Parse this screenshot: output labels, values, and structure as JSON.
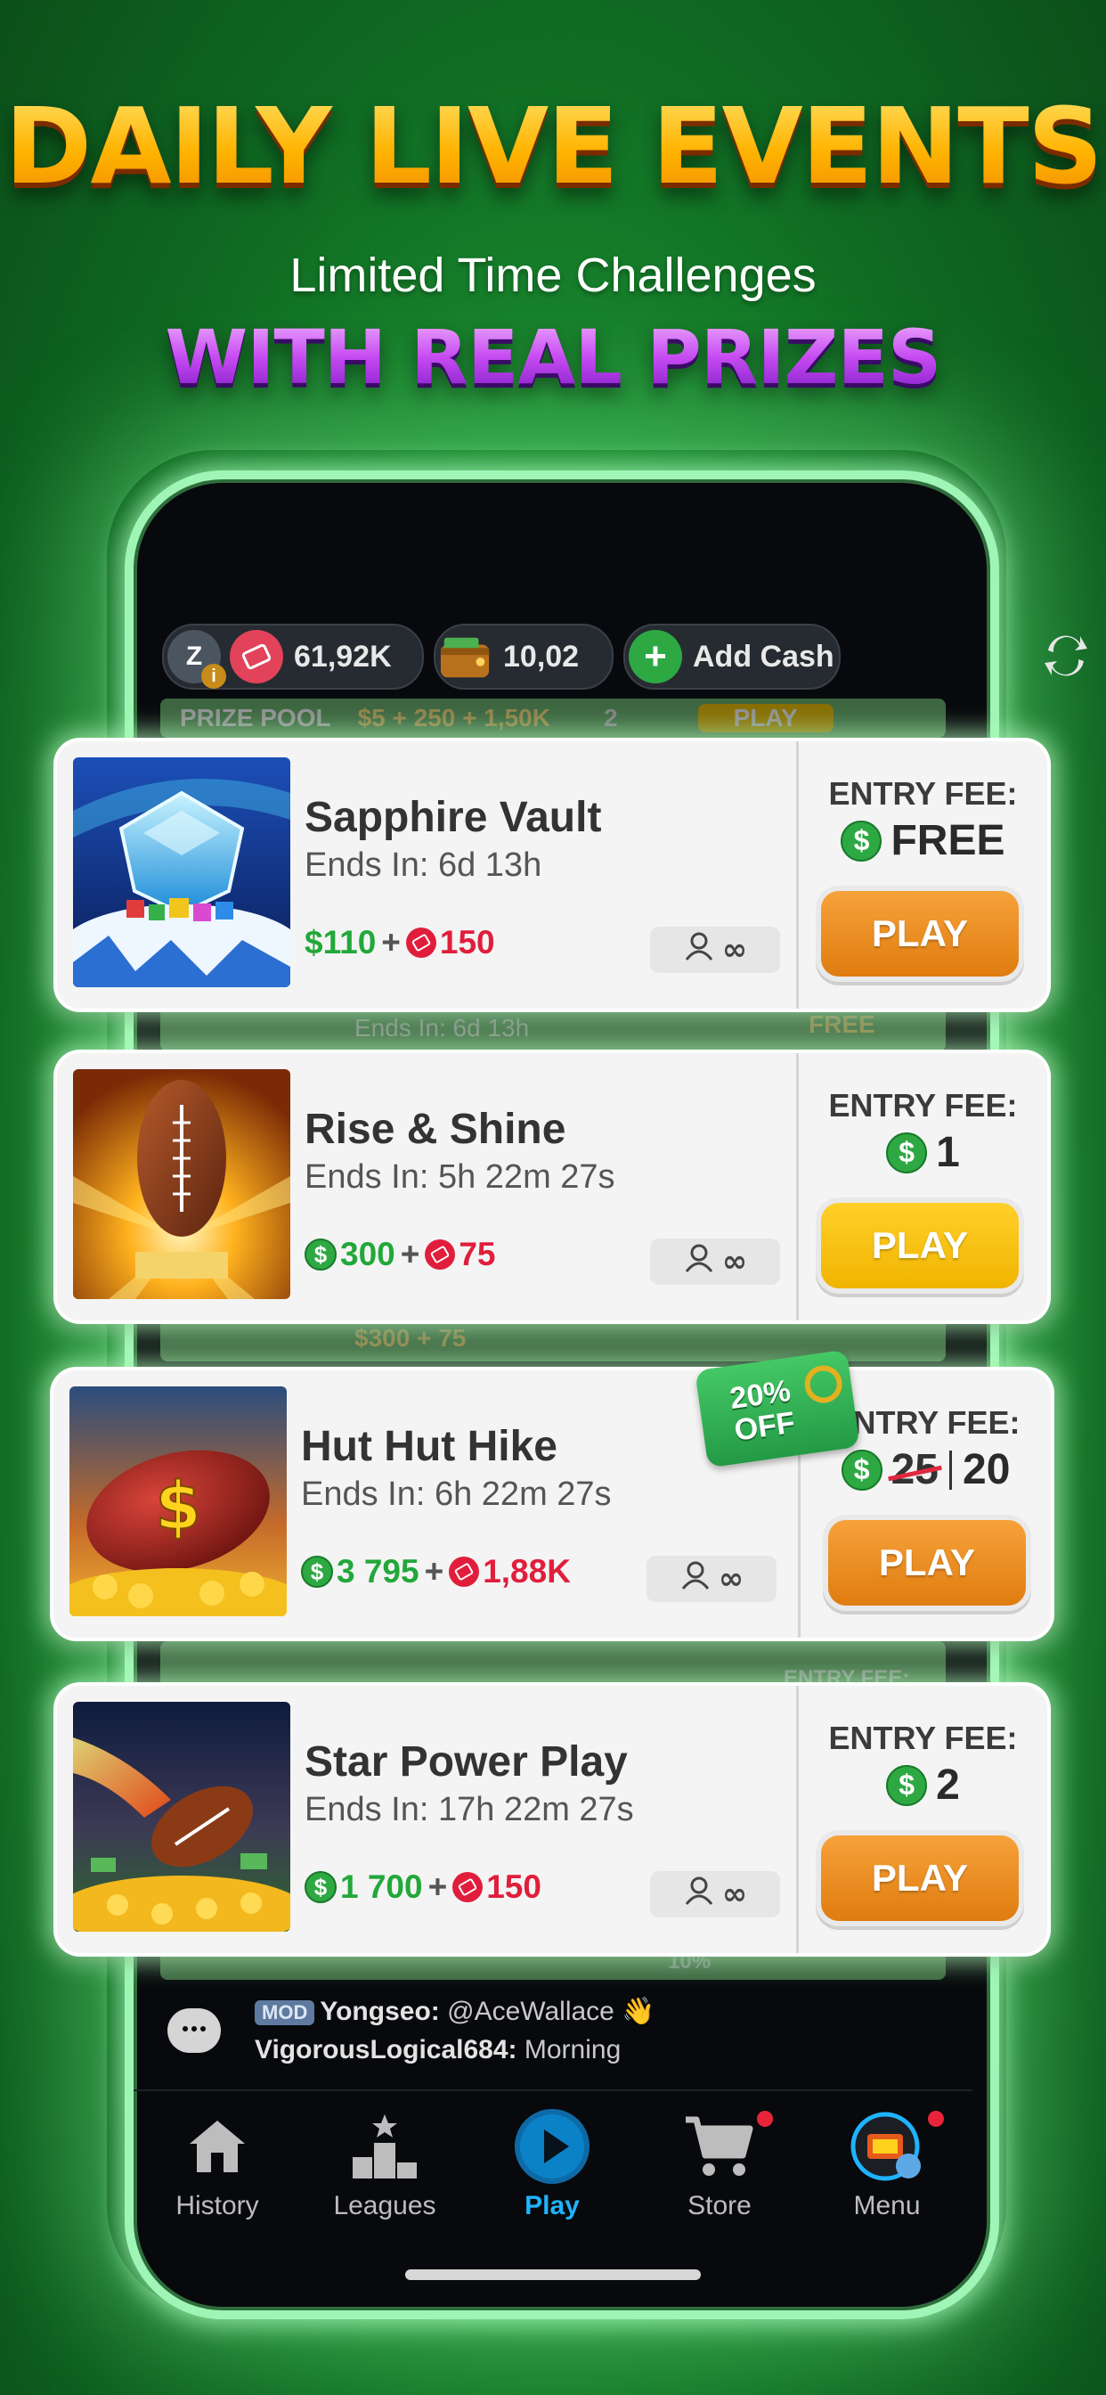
{
  "promo": {
    "headline": "DAILY LIVE EVENTS",
    "subline": "Limited Time Challenges",
    "prize_line": "WITH REAL PRIZES"
  },
  "topbar": {
    "avatar_letter": "Z",
    "tickets": "61,92K",
    "wallet": "10,02",
    "add_cash": "Add Cash"
  },
  "ghosts": {
    "prize_pool": "PRIZE POOL",
    "prize_values": "$5 + 250 + 1,50K",
    "players": "2",
    "play": "PLAY",
    "ends": "Ends In: 6d 13h",
    "free": "FREE",
    "row2": "$300 + 75",
    "entry_fee": "ENTRY FEE:",
    "discount": "10%"
  },
  "cards": [
    {
      "title": "Sapphire Vault",
      "ends": "Ends In: 6d 13h",
      "cash": "$110",
      "tickets": "150",
      "players": "∞",
      "fee_label": "ENTRY FEE:",
      "fee": "FREE",
      "play": "PLAY"
    },
    {
      "title": "Rise & Shine",
      "ends": "Ends In: 5h 22m 27s",
      "cash": "300",
      "tickets": "75",
      "players": "∞",
      "fee_label": "ENTRY FEE:",
      "fee": "1",
      "play": "PLAY"
    },
    {
      "title": "Hut Hut Hike",
      "ends": "Ends In: 6h 22m 27s",
      "cash": "3 795",
      "tickets": "1,88K",
      "players": "∞",
      "fee_label": "ENTRY FEE:",
      "fee_old": "25",
      "fee": "20",
      "discount": "20% OFF",
      "play": "PLAY"
    },
    {
      "title": "Star Power Play",
      "ends": "Ends In: 17h 22m 27s",
      "cash": "1 700",
      "tickets": "150",
      "players": "∞",
      "fee_label": "ENTRY FEE:",
      "fee": "2",
      "play": "PLAY"
    }
  ],
  "chat": {
    "mod_badge": "MOD",
    "line1_user": "Yongseo:",
    "line1_text": " @AceWallace 👋",
    "line2_user": "VigorousLogical684:",
    "line2_text": " Morning"
  },
  "nav": {
    "items": [
      "History",
      "Leagues",
      "Play",
      "Store",
      "Menu"
    ]
  },
  "colors": {
    "accent": "#1fb3ff",
    "cash_green": "#22a83a",
    "ticket_red": "#e01e3c",
    "play_orange": "#e88a1c",
    "play_yellow": "#f5c10e"
  }
}
